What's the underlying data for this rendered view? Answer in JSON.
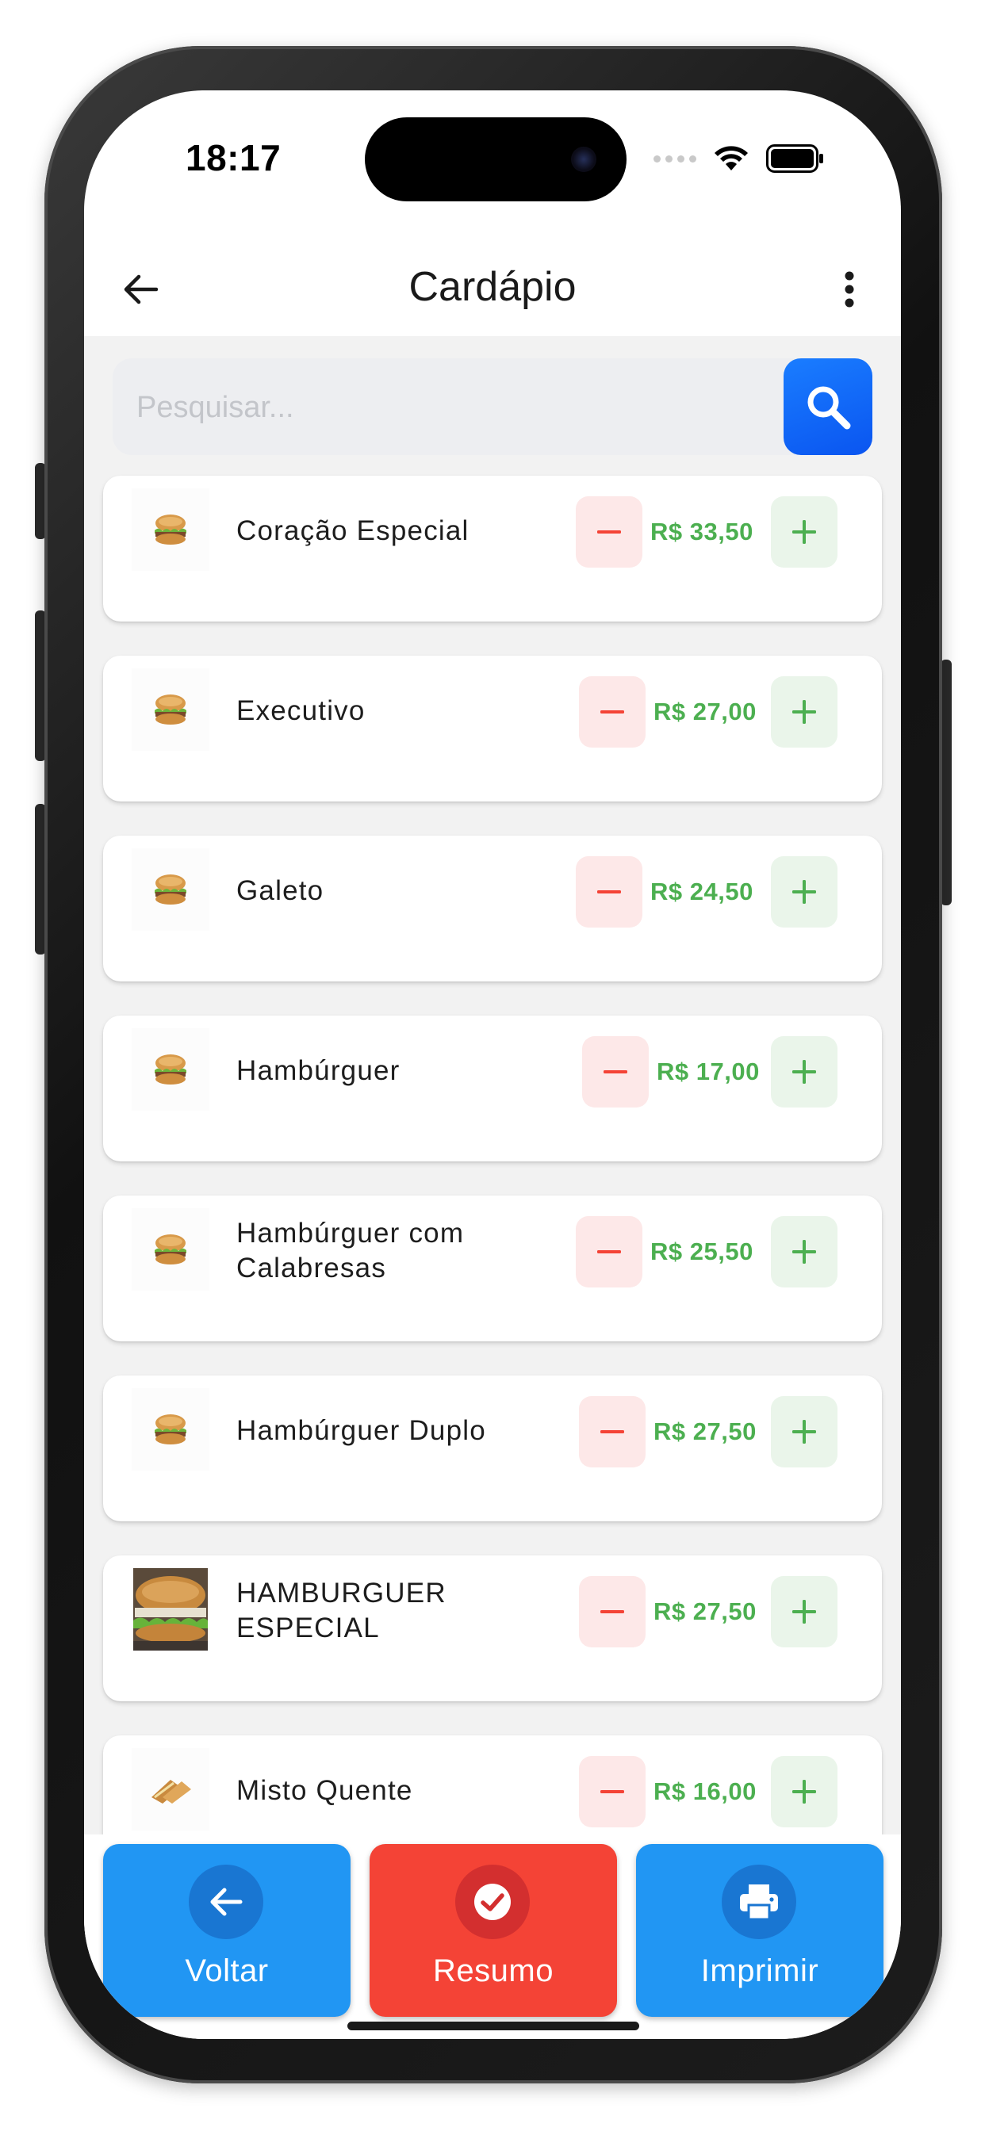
{
  "status_bar": {
    "time": "18:17"
  },
  "app_bar": {
    "title": "Cardápio",
    "back_icon": "arrow-left-icon",
    "menu_icon": "more-vertical-icon"
  },
  "search": {
    "placeholder": "Pesquisar...",
    "value": "",
    "icon": "search-icon"
  },
  "colors": {
    "primary_blue": "#2196f3",
    "danger_red": "#f44336",
    "price_green": "#4caf50",
    "minus_bg": "#fde8e8",
    "plus_bg": "#eaf5ea"
  },
  "items": [
    {
      "name": "Coração Especial",
      "price": "R$ 33,50"
    },
    {
      "name": "Executivo",
      "price": "R$ 27,00"
    },
    {
      "name": "Galeto",
      "price": "R$ 24,50"
    },
    {
      "name": "Hambúrguer",
      "price": "R$ 17,00"
    },
    {
      "name": "Hambúrguer com Calabresas",
      "price": "R$ 25,50"
    },
    {
      "name": "Hambúrguer Duplo",
      "price": "R$ 27,50"
    },
    {
      "name": "HAMBURGUER ESPECIAL",
      "price": "R$ 27,50"
    },
    {
      "name": "Misto Quente",
      "price": "R$ 16,00"
    }
  ],
  "actions": {
    "back": {
      "label": "Voltar",
      "icon": "arrow-left-icon"
    },
    "summary": {
      "label": "Resumo",
      "icon": "check-circle-icon"
    },
    "print": {
      "label": "Imprimir",
      "icon": "printer-icon"
    }
  }
}
